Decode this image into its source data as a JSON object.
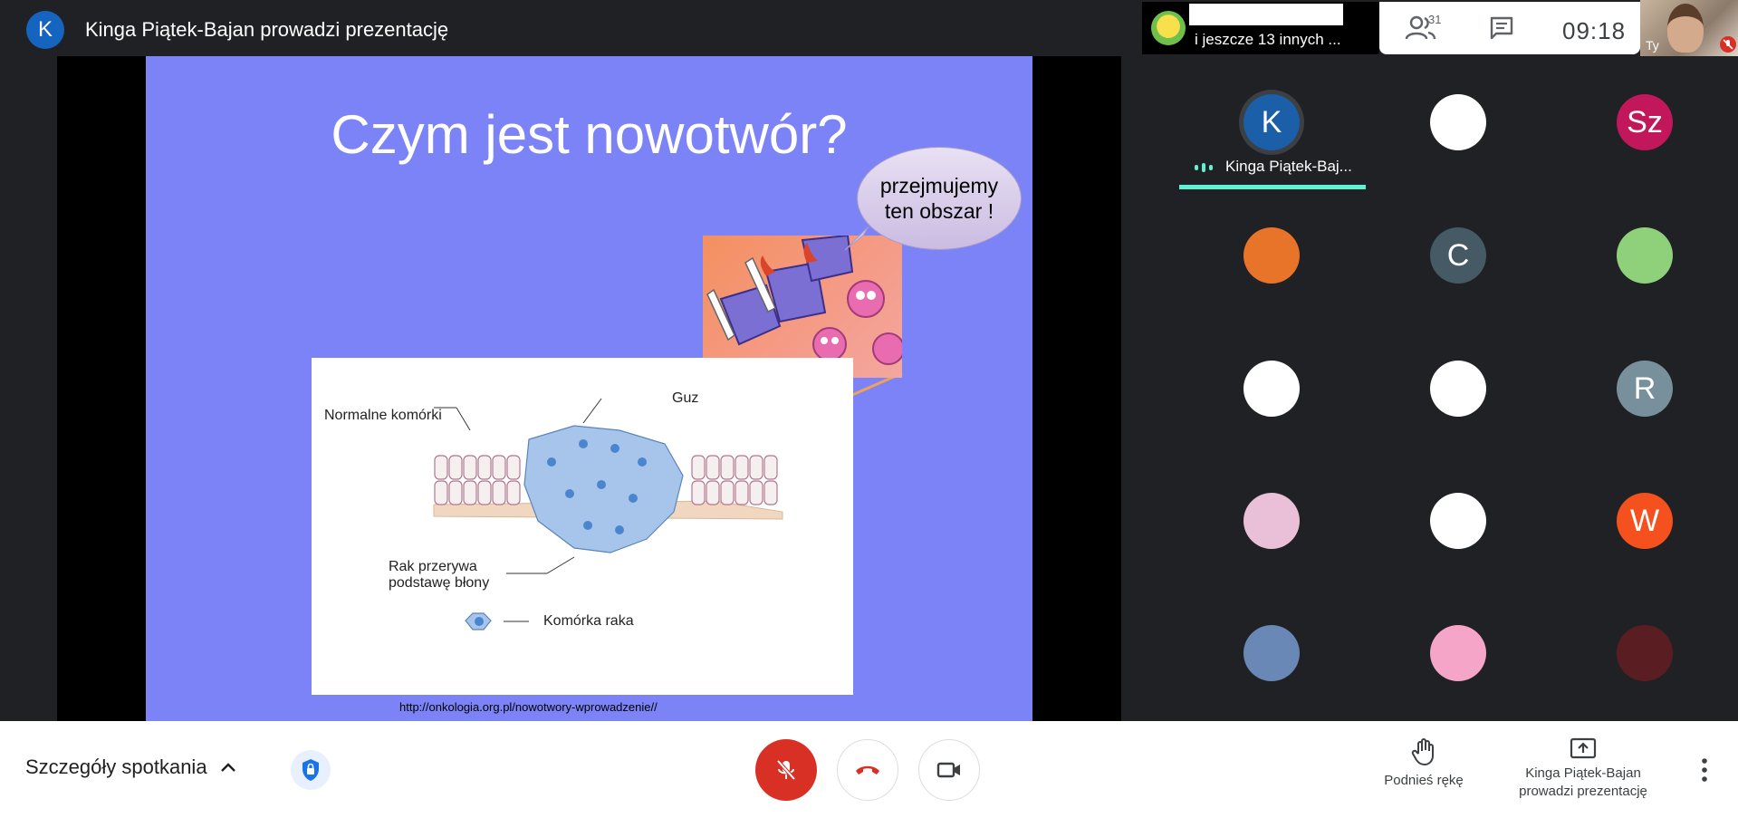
{
  "topbar": {
    "presenter_initial": "K",
    "presenter_title": "Kinga Piątek-Bajan prowadzi prezentację",
    "others_label": "i jeszcze 13 innych ...",
    "participant_count": "31",
    "clock": "09:18",
    "self_label": "Ty"
  },
  "slide": {
    "title": "Czym jest nowotwór?",
    "bubble_line1": "przejmujemy",
    "bubble_line2": "ten obszar !",
    "label_normal": "Normalne komórki",
    "label_guz": "Guz",
    "label_rak_line1": "Rak przerywa",
    "label_rak_line2": "podstawę błony",
    "label_cancer_cell": "Komórka raka",
    "source_url": "http://onkologia.org.pl/nowotwory-wprowadzenie//"
  },
  "participants": {
    "speaker_name": "Kinga Piątek-Baj...",
    "tiles": [
      {
        "initial": "K",
        "color": "#1a5fa8",
        "icon": "initial-avatar"
      },
      {
        "initial": "",
        "color": "#ffffff",
        "icon": "kfc-colonel-avatar"
      },
      {
        "initial": "Sz",
        "color": "#c2185b",
        "icon": "initial-avatar"
      },
      {
        "initial": "",
        "color": "#e8742a",
        "icon": "velma-avatar"
      },
      {
        "initial": "C",
        "color": "#455a64",
        "icon": "initial-avatar"
      },
      {
        "initial": "",
        "color": "#8fd17a",
        "icon": "patrick-star-avatar"
      },
      {
        "initial": "",
        "color": "#ffffff",
        "icon": "penguin-avatar"
      },
      {
        "initial": "",
        "color": "#ffffff",
        "icon": "scooby-doo-avatar"
      },
      {
        "initial": "R",
        "color": "#78909c",
        "icon": "initial-avatar"
      },
      {
        "initial": "",
        "color": "#e9c0d8",
        "icon": "rapunzel-avatar"
      },
      {
        "initial": "",
        "color": "#ffffff",
        "icon": "blank-avatar"
      },
      {
        "initial": "W",
        "color": "#f4511e",
        "icon": "initial-avatar"
      },
      {
        "initial": "",
        "color": "#6a88b5",
        "icon": "elsa-avatar"
      },
      {
        "initial": "",
        "color": "#f5a5c7",
        "icon": "fairy-avatar"
      },
      {
        "initial": "",
        "color": "#5a1e22",
        "icon": "snow-white-avatar"
      }
    ]
  },
  "bottombar": {
    "details_label": "Szczegóły spotkania",
    "raise_hand_label": "Podnieś rękę",
    "presenting_line1": "Kinga Piątek-Bajan",
    "presenting_line2": "prowadzi prezentację"
  }
}
